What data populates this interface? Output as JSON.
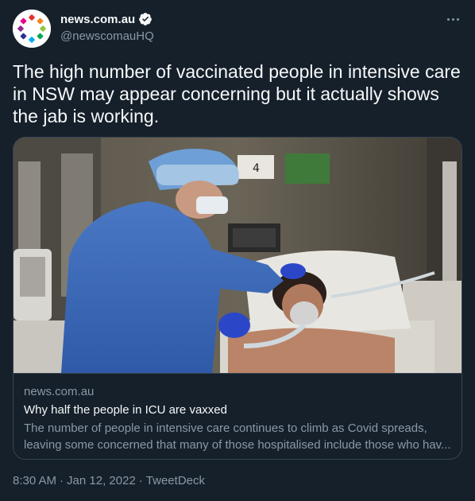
{
  "author": {
    "display_name": "news.com.au",
    "handle": "@newscomauHQ",
    "avatar_icon": "newscomau-logo-icon",
    "verified_icon": "verified-badge-icon"
  },
  "more_icon": "more-options-icon",
  "tweet": {
    "text": "The high number of vaccinated people in intensive care in NSW may appear concerning but it actually shows the jab is working."
  },
  "card": {
    "image_icon": "icu-photo",
    "image_sign_number": "4",
    "domain": "news.com.au",
    "title": "Why half the people in ICU are vaxxed",
    "description": "The number of people in intensive care continues to climb as Covid spreads, leaving some concerned that many of those hospitalised include those who hav..."
  },
  "footer": {
    "time": "8:30 AM",
    "separator": "·",
    "date": "Jan 12, 2022",
    "source": "TweetDeck"
  },
  "colors": {
    "background": "#15202b",
    "text_primary": "#f7f9f9",
    "text_secondary": "#8b98a5",
    "border": "#38444d",
    "verified": "#1d9bf0"
  }
}
